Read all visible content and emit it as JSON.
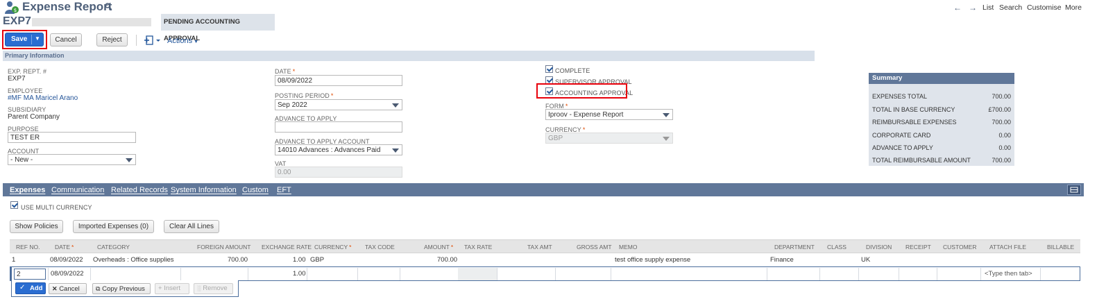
{
  "header": {
    "title": "Expense Report",
    "record_id": "EXP7",
    "status": "PENDING ACCOUNTING APPROVAL",
    "nav": [
      "List",
      "Search",
      "Customise",
      "More"
    ]
  },
  "toolbar": {
    "save": "Save",
    "cancel": "Cancel",
    "reject": "Reject",
    "actions": "Actions"
  },
  "primary": {
    "section_title": "Primary Information",
    "exp_rept_label": "EXP. REPT. #",
    "exp_rept_value": "EXP7",
    "employee_label": "EMPLOYEE",
    "employee_value": "#MF MA Maricel Arano",
    "subsidiary_label": "SUBSIDIARY",
    "subsidiary_value": "Parent Company",
    "purpose_label": "PURPOSE",
    "purpose_value": "TEST ER",
    "account_label": "ACCOUNT",
    "account_value": "- New -",
    "date_label": "DATE",
    "date_value": "08/09/2022",
    "posting_label": "POSTING PERIOD",
    "posting_value": "Sep 2022",
    "advance_label": "ADVANCE TO APPLY",
    "advance_value": "",
    "advance_acct_label": "ADVANCE TO APPLY ACCOUNT",
    "advance_acct_value": "14010 Advances : Advances Paid",
    "vat_label": "VAT",
    "vat_value": "0.00",
    "complete_label": "COMPLETE",
    "supervisor_label": "SUPERVISOR APPROVAL",
    "accounting_label": "ACCOUNTING APPROVAL",
    "form_label": "FORM",
    "form_value": "Iproov - Expense Report",
    "currency_label": "CURRENCY",
    "currency_value": "GBP"
  },
  "summary": {
    "title": "Summary",
    "rows": [
      {
        "label": "EXPENSES TOTAL",
        "value": "700.00"
      },
      {
        "label": "TOTAL IN BASE CURRENCY",
        "value": "£700.00"
      },
      {
        "label": "REIMBURSABLE EXPENSES",
        "value": "700.00"
      },
      {
        "label": "CORPORATE CARD",
        "value": "0.00"
      },
      {
        "label": "ADVANCE TO APPLY",
        "value": "0.00"
      },
      {
        "label": "TOTAL REIMBURSABLE AMOUNT",
        "value": "700.00"
      }
    ]
  },
  "tabs": [
    "Expenses",
    "Communication",
    "Related Records",
    "System Information",
    "Custom",
    "EFT"
  ],
  "expenses": {
    "multi_currency_label": "USE MULTI CURRENCY",
    "show_policies": "Show Policies",
    "imported": "Imported Expenses (0)",
    "clear_all": "Clear All Lines",
    "columns": [
      "REF NO.",
      "DATE",
      "CATEGORY",
      "FOREIGN AMOUNT",
      "EXCHANGE RATE",
      "CURRENCY",
      "TAX CODE",
      "AMOUNT",
      "TAX RATE",
      "TAX AMT",
      "GROSS AMT",
      "MEMO",
      "DEPARTMENT",
      "CLASS",
      "DIVISION",
      "RECEIPT",
      "CUSTOMER",
      "ATTACH FILE",
      "BILLABLE"
    ],
    "row1": {
      "ref": "1",
      "date": "08/09/2022",
      "category": "Overheads : Office supplies",
      "foreign_amount": "700.00",
      "exchange_rate": "1.00",
      "currency": "GBP",
      "amount": "700.00",
      "memo": "test office supply expense",
      "department": "Finance",
      "division": "UK"
    },
    "edit_row": {
      "ref": "2",
      "date": "08/09/2022",
      "exchange_rate": "1.00",
      "attach": "<Type then tab>"
    },
    "buttons": {
      "add": "Add",
      "cancel": "Cancel",
      "copy_previous": "Copy Previous",
      "insert": "Insert",
      "remove": "Remove"
    }
  },
  "colors": {
    "primary_blue": "#2a6dd1",
    "section_bar": "#d8e0ea",
    "tab_bar": "#607799",
    "summary_bg": "#dfe4eb",
    "highlight": "#e8000b"
  }
}
